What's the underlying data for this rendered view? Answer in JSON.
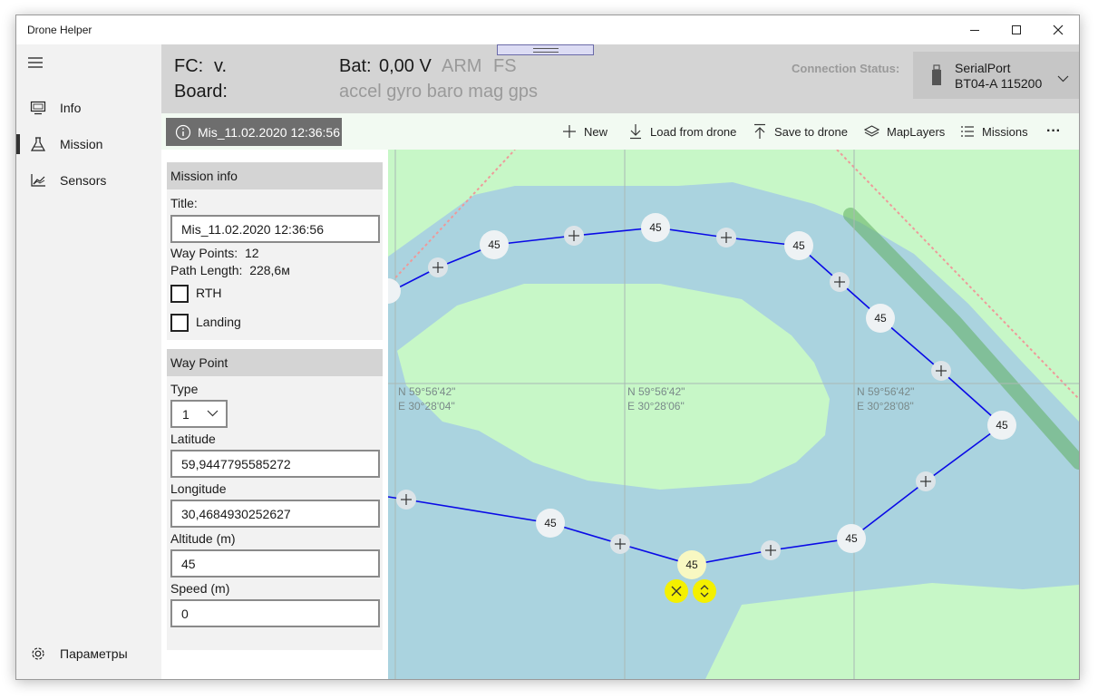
{
  "app": {
    "title": "Drone Helper"
  },
  "window_controls": {
    "minimize": "—",
    "maximize": "☐",
    "close": "✕"
  },
  "nav": {
    "items": [
      {
        "label": "Info",
        "icon": "monitor-icon"
      },
      {
        "label": "Mission",
        "icon": "flask-icon"
      },
      {
        "label": "Sensors",
        "icon": "chart-icon"
      }
    ],
    "settings_label": "Параметры",
    "active": "Mission"
  },
  "status": {
    "fc_label": "FC:",
    "fc_value": "v.",
    "board_label": "Board:",
    "bat_label": "Bat:",
    "bat_value": "0,00 V",
    "arm": "ARM",
    "fs": "FS",
    "sensors": "accel gyro baro mag gps",
    "connection_label": "Connection Status:",
    "port_name": "SerialPort",
    "port_detail": "BT04-A 115200"
  },
  "toolbar": {
    "mission_name": "Mis_11.02.2020 12:36:56",
    "buttons": [
      "New",
      "Load from drone",
      "Save to drone",
      "MapLayers",
      "Missions"
    ],
    "more": "···"
  },
  "mission_info": {
    "header": "Mission info",
    "title_label": "Title:",
    "title_value": "Mis_11.02.2020 12:36:56",
    "waypoints_label": "Way Points:",
    "waypoints_value": "12",
    "path_label": "Path Length:",
    "path_value": "228,6м",
    "rth_label": "RTH",
    "rth_checked": false,
    "landing_label": "Landing",
    "landing_checked": false
  },
  "waypoint": {
    "header": "Way Point",
    "type_label": "Type",
    "type_value": "1",
    "lat_label": "Latitude",
    "lat_value": "59,9447795585272",
    "lon_label": "Longitude",
    "lon_value": "30,4684930252627",
    "alt_label": "Altitude (m)",
    "alt_value": "45",
    "speed_label": "Speed (m)",
    "speed_value": "0"
  },
  "map": {
    "grid_labels": [
      {
        "lat": "N 59°56'42\"",
        "lon": "E 30°28'04\""
      },
      {
        "lat": "N 59°56'42\"",
        "lon": "E 30°28'06\""
      },
      {
        "lat": "N 59°56'42\"",
        "lon": "E 30°28'08\""
      }
    ],
    "waypoint_altitude_label": "45",
    "colors": {
      "land": "#c7f7c7",
      "water": "#aad3df",
      "route": "#0000ee",
      "selected": "#f4f000"
    }
  }
}
